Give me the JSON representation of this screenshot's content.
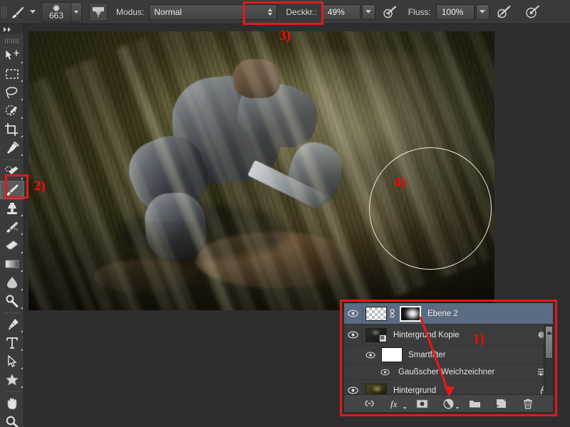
{
  "options_bar": {
    "brush_preset_icon": "brush-icon",
    "brush_size": "663",
    "tablet_pressure_icon": "tablet-pressure-icon",
    "mode_label": "Modus:",
    "mode_value": "Normal",
    "opacity_label": "Deckkr.:",
    "opacity_value": "49%",
    "opacity_pressure_icon": "pressure-opacity-icon",
    "flow_label": "Fluss:",
    "flow_value": "100%",
    "flow_pressure_icon": "pressure-flow-icon",
    "airbrush_icon": "airbrush-icon"
  },
  "toolbox": {
    "tools": [
      {
        "name": "move-tool",
        "selected": false
      },
      {
        "name": "rectangular-marquee-tool",
        "selected": false
      },
      {
        "name": "lasso-tool",
        "selected": false
      },
      {
        "name": "quick-selection-tool",
        "selected": false
      },
      {
        "name": "crop-tool",
        "selected": false
      },
      {
        "name": "eyedropper-tool",
        "selected": false
      },
      {
        "name": "healing-brush-tool",
        "selected": false
      },
      {
        "name": "brush-tool",
        "selected": true
      },
      {
        "name": "clone-stamp-tool",
        "selected": false
      },
      {
        "name": "history-brush-tool",
        "selected": false
      },
      {
        "name": "eraser-tool",
        "selected": false
      },
      {
        "name": "gradient-tool",
        "selected": false
      },
      {
        "name": "blur-tool",
        "selected": false
      },
      {
        "name": "dodge-tool",
        "selected": false
      },
      {
        "name": "pen-tool",
        "selected": false
      },
      {
        "name": "type-tool",
        "selected": false
      },
      {
        "name": "path-selection-tool",
        "selected": false
      },
      {
        "name": "custom-shape-tool",
        "selected": false
      },
      {
        "name": "hand-tool",
        "selected": false
      },
      {
        "name": "zoom-tool",
        "selected": false
      }
    ]
  },
  "layers_panel": {
    "rows": [
      {
        "name": "Ebene 2",
        "selected": true,
        "visible": true,
        "kind": "layer-with-mask",
        "thumb": "transparent-checker",
        "mask_thumb": "layer-mask",
        "linked": true
      },
      {
        "name": "Hintergrund Kopie",
        "selected": false,
        "visible": true,
        "kind": "smart-object",
        "thumb": "photo-dark",
        "has_fx_badge": true
      },
      {
        "name": "Smartfilter",
        "selected": false,
        "visible": true,
        "kind": "smart-filter-group",
        "thumb": "white-mask"
      },
      {
        "name": "Gaußscher Weichzeichner",
        "selected": false,
        "visible": true,
        "kind": "smart-filter",
        "has_settings_icon": true
      },
      {
        "name": "Hintergrund",
        "selected": false,
        "visible": true,
        "kind": "background",
        "thumb": "photo",
        "locked": true
      }
    ],
    "footer_buttons": [
      {
        "name": "link-layers-icon",
        "label": "link"
      },
      {
        "name": "layer-style-fx-icon",
        "label": "fx"
      },
      {
        "name": "add-layer-mask-icon",
        "label": "mask"
      },
      {
        "name": "adjustment-layer-icon",
        "label": "adjustment"
      },
      {
        "name": "new-group-icon",
        "label": "group"
      },
      {
        "name": "new-layer-icon",
        "label": "new"
      },
      {
        "name": "delete-layer-icon",
        "label": "delete"
      }
    ]
  },
  "annotations": {
    "marker_1": "1)",
    "marker_2": "2)",
    "marker_3": "3)",
    "marker_4": "4)",
    "highlight_color": "#e01b1b",
    "text_color": "#ef0d0d"
  },
  "canvas": {
    "brush_cursor": "brush-cursor-ring",
    "document_description": "knight-in-armor-forest-light-rays"
  }
}
